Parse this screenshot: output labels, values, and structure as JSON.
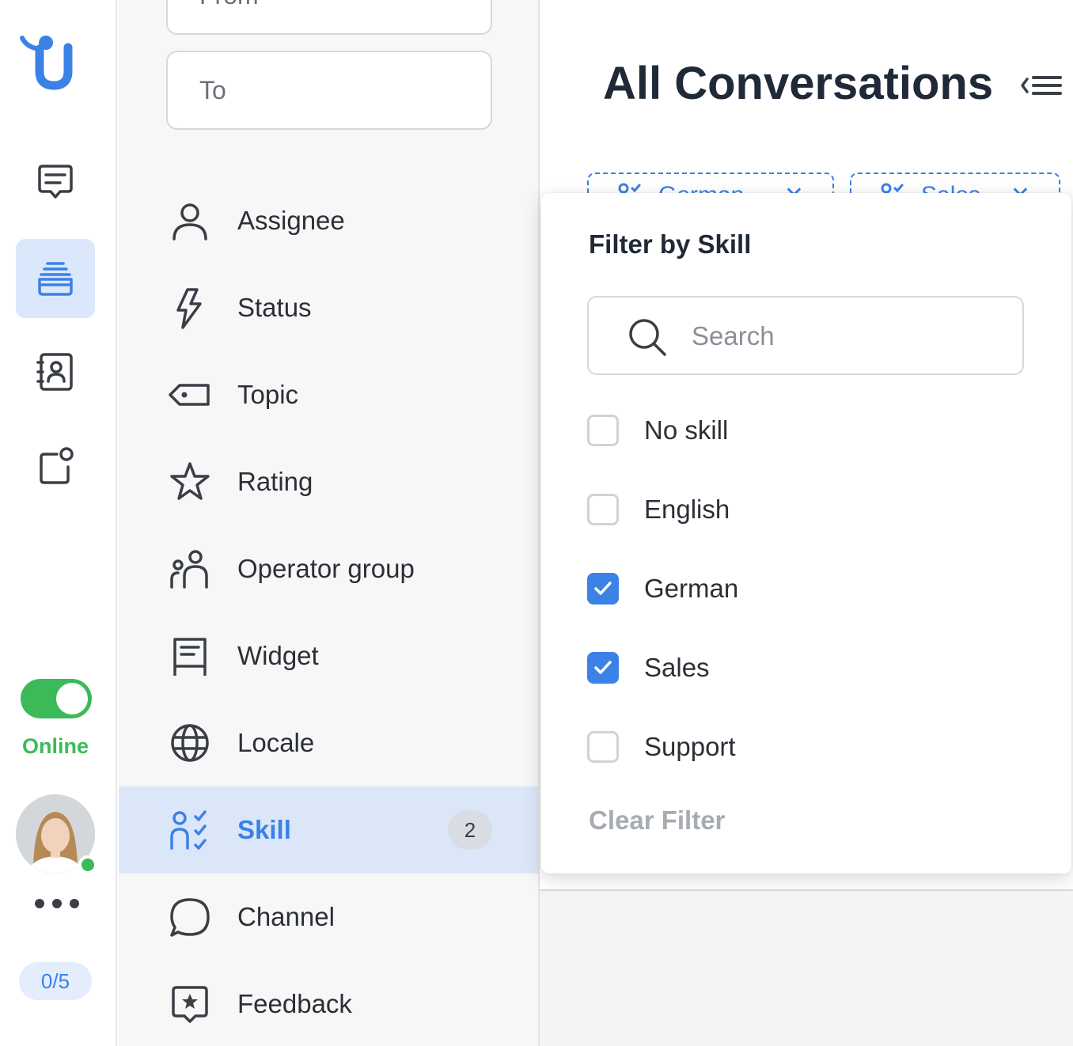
{
  "rail": {
    "status_label": "Online",
    "capacity": "0/5",
    "accent": "#3b82e6",
    "online_color": "#3cba5a",
    "nav": [
      {
        "icon": "chat-bubble-icon",
        "active": false
      },
      {
        "icon": "inbox-stack-icon",
        "active": true
      },
      {
        "icon": "contacts-book-icon",
        "active": false
      },
      {
        "icon": "notification-box-icon",
        "active": false
      }
    ]
  },
  "panel": {
    "from_placeholder": "From",
    "to_placeholder": "To",
    "filters": [
      {
        "label": "Assignee",
        "icon": "user-icon"
      },
      {
        "label": "Status",
        "icon": "lightning-icon"
      },
      {
        "label": "Topic",
        "icon": "tag-icon"
      },
      {
        "label": "Rating",
        "icon": "star-icon"
      },
      {
        "label": "Operator group",
        "icon": "group-icon"
      },
      {
        "label": "Widget",
        "icon": "widget-icon"
      },
      {
        "label": "Locale",
        "icon": "globe-icon"
      },
      {
        "label": "Skill",
        "icon": "skill-icon",
        "count": "2",
        "active": true
      },
      {
        "label": "Channel",
        "icon": "speech-bubble-icon"
      },
      {
        "label": "Feedback",
        "icon": "feedback-star-icon"
      }
    ]
  },
  "main": {
    "title": "All Conversations",
    "chips": [
      "German",
      "Sales"
    ]
  },
  "dropdown": {
    "title": "Filter by Skill",
    "search_placeholder": "Search",
    "options": [
      {
        "label": "No skill",
        "checked": false
      },
      {
        "label": "English",
        "checked": false
      },
      {
        "label": "German",
        "checked": true
      },
      {
        "label": "Sales",
        "checked": true
      },
      {
        "label": "Support",
        "checked": false
      }
    ],
    "clear_label": "Clear Filter"
  }
}
